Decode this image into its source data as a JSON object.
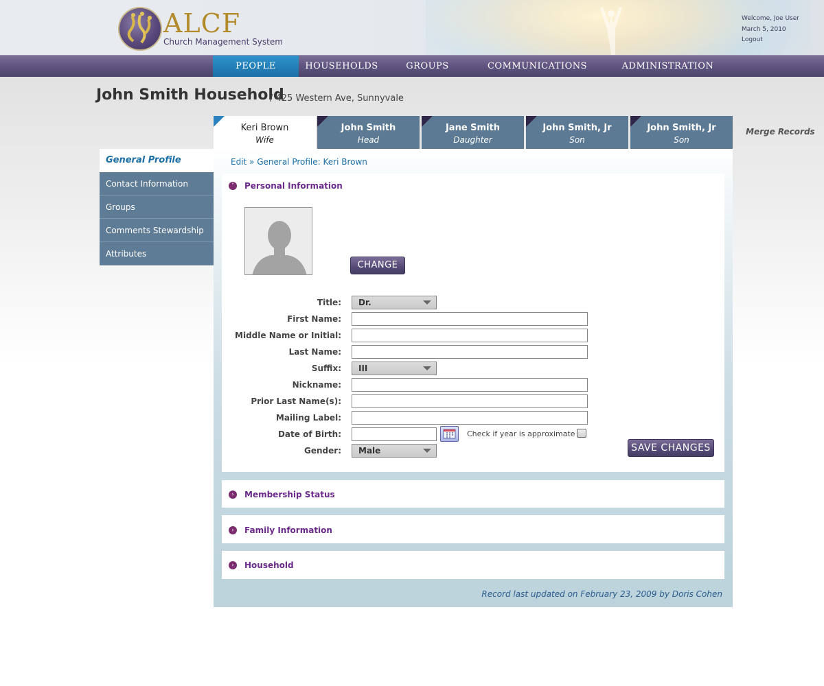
{
  "brand": {
    "name": "ALCF",
    "subtitle": "Church Management System",
    "colors": {
      "nav": "#5f5480",
      "active_nav": "#1b6fa6",
      "accent": "#6b2a8a",
      "tab": "#5c7a94"
    }
  },
  "user": {
    "welcome": "Welcome, Joe User",
    "date": "March 5, 2010",
    "logout": "Logout"
  },
  "nav": {
    "people": "PEOPLE",
    "households": "HOUSEHOLDS",
    "groups": "GROUPS",
    "communications": "COMMUNICATIONS",
    "administration": "ADMINISTRATION"
  },
  "household": {
    "title": "John Smith Household",
    "address": "/  425 Western Ave, Sunnyvale"
  },
  "members": [
    {
      "name": "Keri Brown",
      "role": "Wife"
    },
    {
      "name": "John Smith",
      "role": "Head"
    },
    {
      "name": "Jane Smith",
      "role": "Daughter"
    },
    {
      "name": "John Smith, Jr",
      "role": "Son"
    },
    {
      "name": "John Smith, Jr",
      "role": "Son"
    }
  ],
  "merge_records": "Merge Records",
  "side_menu": [
    "General Profile",
    "Contact Information",
    "Groups",
    "Comments Stewardship",
    "Attributes"
  ],
  "breadcrumb": "Edit » General Profile: Keri Brown",
  "sections": {
    "personal": "Personal Information",
    "membership": "Membership Status",
    "family": "Family Information",
    "household": "Household"
  },
  "buttons": {
    "change": "CHANGE",
    "save": "SAVE CHANGES"
  },
  "form": {
    "title_label": "Title",
    "title_value": "Dr.",
    "first_name_label": "First Name",
    "middle_name_label": "Middle Name or Initial",
    "last_name_label": "Last Name",
    "suffix_label": "Suffix",
    "suffix_value": "III",
    "nickname_label": "Nickname",
    "prior_last_label": "Prior Last Name(s)",
    "mailing_label": "Mailing Label",
    "dob_label": "Date of Birth",
    "approx_label": "Check if year is approximate",
    "gender_label": "Gender",
    "gender_value": "Male",
    "colon": ":"
  },
  "record_note": "Record last updated on February 23, 2009 by Doris Cohen"
}
